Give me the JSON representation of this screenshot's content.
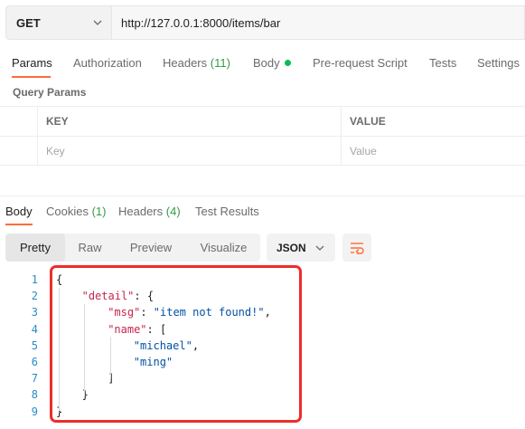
{
  "request": {
    "method": "GET",
    "url": "http://127.0.0.1:8000/items/bar"
  },
  "request_tabs": [
    {
      "label": "Params",
      "active": true
    },
    {
      "label": "Authorization"
    },
    {
      "label": "Headers",
      "count": "(11)"
    },
    {
      "label": "Body",
      "has_dot": true
    },
    {
      "label": "Pre-request Script"
    },
    {
      "label": "Tests"
    },
    {
      "label": "Settings"
    }
  ],
  "query_params": {
    "title": "Query Params",
    "headers": {
      "key": "KEY",
      "value": "VALUE"
    },
    "placeholder_row": {
      "key": "Key",
      "value": "Value"
    }
  },
  "response_tabs": [
    {
      "label": "Body",
      "active": true
    },
    {
      "label": "Cookies",
      "count": "(1)"
    },
    {
      "label": "Headers",
      "count": "(4)"
    },
    {
      "label": "Test Results"
    }
  ],
  "view_modes": [
    "Pretty",
    "Raw",
    "Preview",
    "Visualize"
  ],
  "active_view": "Pretty",
  "format": "JSON",
  "response_body": {
    "line_numbers": [
      "1",
      "2",
      "3",
      "4",
      "5",
      "6",
      "7",
      "8",
      "9"
    ],
    "lines": [
      [
        {
          "t": "{",
          "c": "p"
        }
      ],
      [
        {
          "t": "\"detail\"",
          "c": "k"
        },
        {
          "t": ": {",
          "c": "p"
        }
      ],
      [
        {
          "t": "\"msg\"",
          "c": "k"
        },
        {
          "t": ": ",
          "c": "p"
        },
        {
          "t": "\"item not found!\"",
          "c": "s"
        },
        {
          "t": ",",
          "c": "p"
        }
      ],
      [
        {
          "t": "\"name\"",
          "c": "k"
        },
        {
          "t": ": [",
          "c": "p"
        }
      ],
      [
        {
          "t": "\"michael\"",
          "c": "s"
        },
        {
          "t": ",",
          "c": "p"
        }
      ],
      [
        {
          "t": "\"ming\"",
          "c": "s"
        }
      ],
      [
        {
          "t": "]",
          "c": "p"
        }
      ],
      [
        {
          "t": "}",
          "c": "p"
        }
      ],
      [
        {
          "t": "}",
          "c": "p"
        }
      ]
    ]
  },
  "colors": {
    "accent": "#ff6c37",
    "highlight_box": "#ee2c2c",
    "json_key": "#c7254e",
    "json_string": "#0451a5",
    "count_green": "#2f9e44",
    "line_number": "#2a8cc8"
  },
  "icons": {
    "method_dropdown": "chevron-down-icon",
    "format_dropdown": "chevron-down-icon",
    "wrap": "wrap-lines-icon"
  }
}
